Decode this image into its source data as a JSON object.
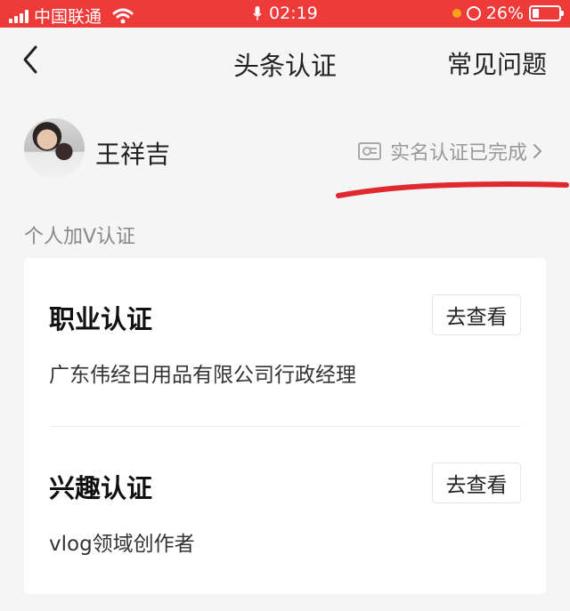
{
  "status_bar": {
    "carrier": "中国联通",
    "time": "02:19",
    "battery_percent": "26%",
    "battery_level": 0.26,
    "accent_color": "#ee3a39"
  },
  "nav": {
    "title": "头条认证",
    "faq_label": "常见问题",
    "back_icon": "chevron-left-icon"
  },
  "user": {
    "name": "王祥吉",
    "verify_status": "实名认证已完成",
    "verify_icon": "id-card-icon"
  },
  "section_label": "个人加V认证",
  "certifications": [
    {
      "title": "职业认证",
      "description": "广东伟经日用品有限公司行政经理",
      "button_label": "去查看"
    },
    {
      "title": "兴趣认证",
      "description": "vlog领域创作者",
      "button_label": "去查看"
    }
  ],
  "annotation_color": "#e0282f"
}
